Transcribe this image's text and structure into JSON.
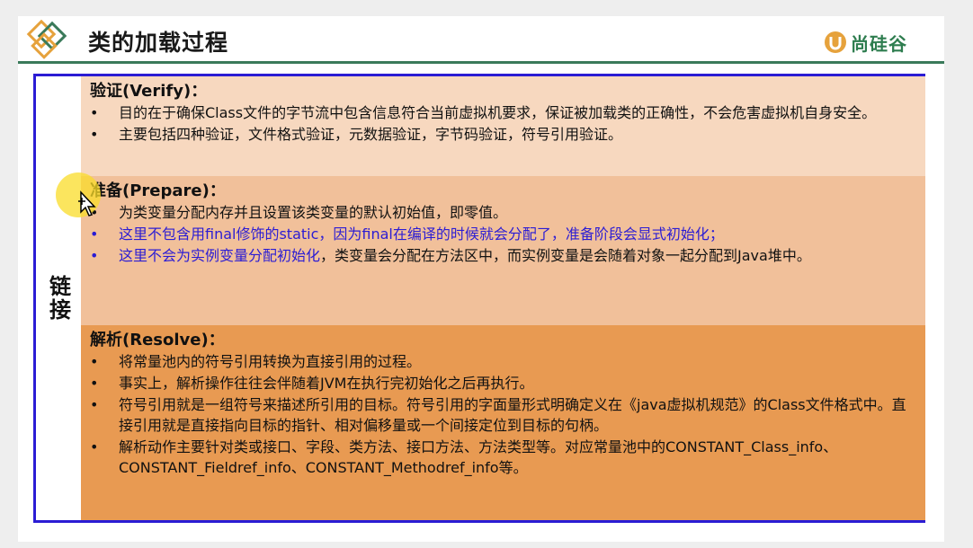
{
  "header": {
    "title": "类的加载过程",
    "brand": "尚硅谷"
  },
  "side_label": "链接",
  "sections": [
    {
      "title": "验证(Verify)：",
      "items": [
        {
          "text": "目的在于确保Class文件的字节流中包含信息符合当前虚拟机要求，保证被加载类的正确性，不会危害虚拟机自身安全。",
          "highlight": false
        },
        {
          "text": "主要包括四种验证，文件格式验证，元数据验证，字节码验证，符号引用验证。",
          "highlight": false
        }
      ]
    },
    {
      "title": "准备(Prepare)：",
      "items": [
        {
          "text": "为类变量分配内存并且设置该类变量的默认初始值，即零值。",
          "highlight": false
        },
        {
          "text": "这里不包含用final修饰的static，因为final在编译的时候就会分配了，准备阶段会显式初始化；",
          "highlight": true
        },
        {
          "prefix": "这里不会为实例变量分配初始化",
          "text": "，类变量会分配在方法区中，而实例变量是会随着对象一起分配到Java堆中。",
          "highlight": "partial"
        }
      ]
    },
    {
      "title": "解析(Resolve)：",
      "items": [
        {
          "text": "将常量池内的符号引用转换为直接引用的过程。",
          "highlight": false
        },
        {
          "text": "事实上，解析操作往往会伴随着JVM在执行完初始化之后再执行。",
          "highlight": false
        },
        {
          "text": "符号引用就是一组符号来描述所引用的目标。符号引用的字面量形式明确定义在《java虚拟机规范》的Class文件格式中。直接引用就是直接指向目标的指针、相对偏移量或一个间接定位到目标的句柄。",
          "highlight": false
        },
        {
          "text": "解析动作主要针对类或接口、字段、类方法、接口方法、方法类型等。对应常量池中的CONSTANT_Class_info、CONSTANT_Fieldref_info、CONSTANT_Methodref_info等。",
          "highlight": false
        }
      ]
    }
  ],
  "bullet": "•",
  "colors": {
    "border": "#2b1cd4",
    "highlight_text": "#2b1cd4",
    "verify_bg": "#f7d8bf",
    "prepare_bg": "#f1c09a",
    "resolve_bg": "#e89a52",
    "brand": "#2e7d4f"
  },
  "icons": {
    "logo": "diamond-logo-icon",
    "brand": "brand-logo-icon",
    "cursor": "move-cursor-icon"
  }
}
